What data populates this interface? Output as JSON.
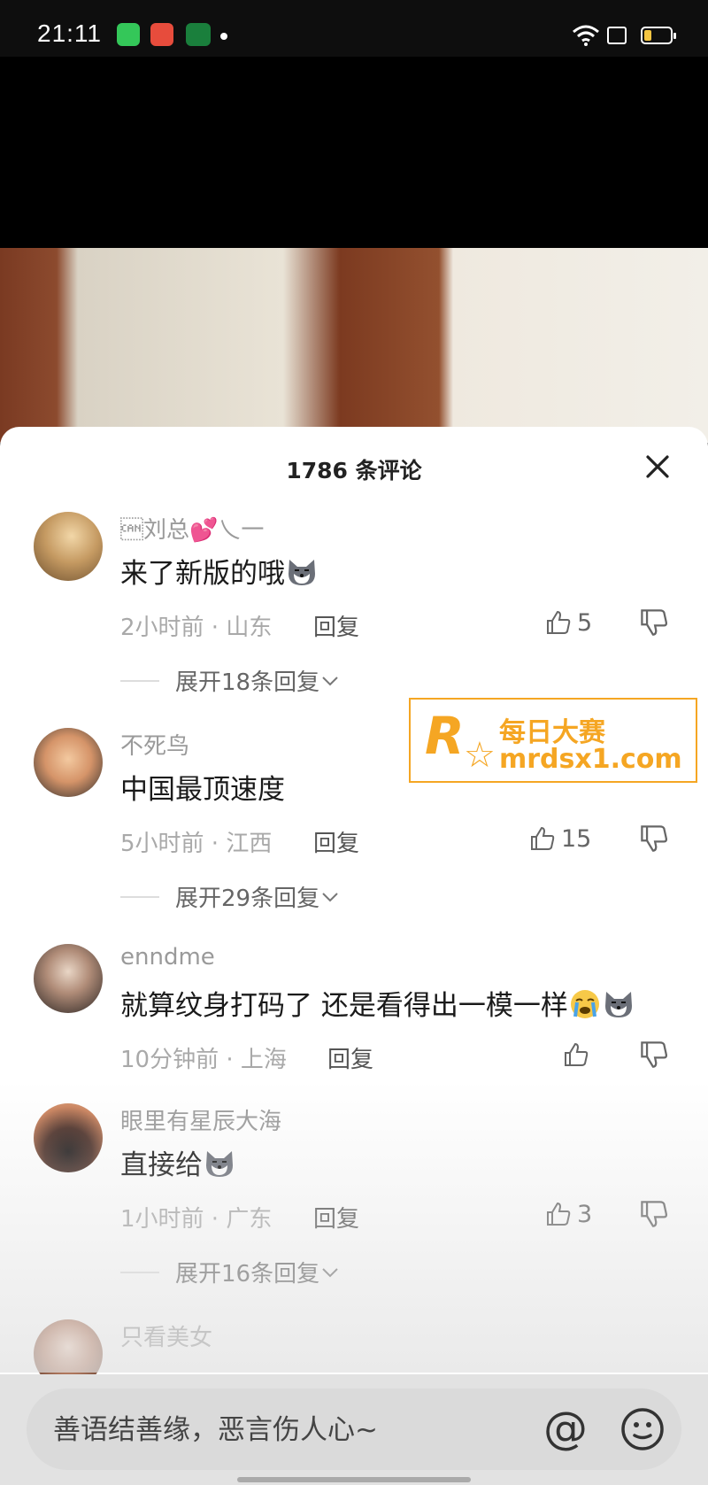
{
  "status_bar": {
    "time": "21:11"
  },
  "sheet": {
    "title": "1786 条评论"
  },
  "comments": [
    {
      "user": "\u0018刘总💕乀一",
      "text": "来了新版的哦",
      "meta": "2小时前 · 山东",
      "reply": "回复",
      "likes": "5",
      "expand": "展开18条回复"
    },
    {
      "user": "不死鸟",
      "text": "中国最顶速度",
      "meta": "5小时前 · 江西",
      "reply": "回复",
      "likes": "15",
      "expand": "展开29条回复"
    },
    {
      "user": "enndme",
      "text": "就算纹身打码了 还是看得出一模一样",
      "meta": "10分钟前 · 上海",
      "reply": "回复",
      "likes": ""
    },
    {
      "user": "眼里有星辰大海",
      "text": "直接给",
      "meta": "1小时前 · 广东",
      "reply": "回复",
      "likes": "3",
      "expand": "展开16条回复"
    },
    {
      "user": "只看美女"
    }
  ],
  "watermark": {
    "logo_letter": "R",
    "cn": "每日大赛",
    "url": "mrdsx1.com"
  },
  "input": {
    "placeholder": "善语结善缘，恶言伤人心~",
    "at_symbol": "@"
  },
  "icons": [
    "close-icon",
    "thumb-up-icon",
    "thumb-down-icon",
    "dog-emoji-icon",
    "crying-emoji-icon",
    "at-icon",
    "emoji-icon",
    "wifi-icon",
    "battery-icon"
  ],
  "colors": {
    "accent": "#f5a623",
    "muted": "#9a9a9a",
    "text": "#1a1a1a"
  }
}
